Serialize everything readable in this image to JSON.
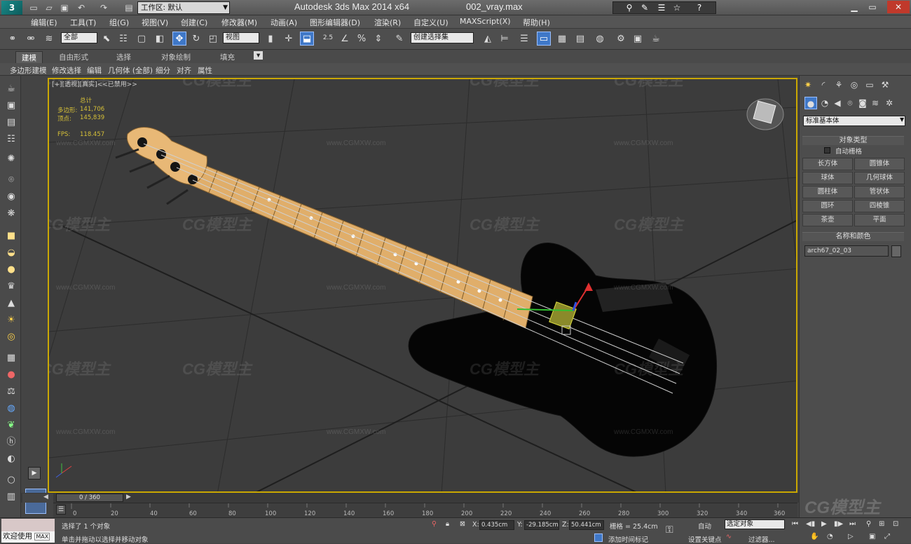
{
  "titlebar": {
    "workspace_label": "工作区: 默认",
    "app_name": "Autodesk 3ds Max  2014 x64",
    "file_name": "002_vray.max"
  },
  "menu": [
    "编辑(E)",
    "工具(T)",
    "组(G)",
    "视图(V)",
    "创建(C)",
    "修改器(M)",
    "动画(A)",
    "图形编辑器(D)",
    "渲染(R)",
    "自定义(U)",
    "MAXScript(X)",
    "帮助(H)"
  ],
  "toolbar": {
    "filter_select": "全部",
    "ref_coord_select": "视图",
    "snap_value": "2.5",
    "named_selection": "创建选择集"
  },
  "ribbon": {
    "tabs": [
      "建模",
      "自由形式",
      "选择",
      "对象绘制",
      "填充"
    ],
    "subitems": [
      "多边形建模",
      "修改选择",
      "编辑",
      "几何体 (全部)",
      "细分",
      "对齐",
      "属性"
    ]
  },
  "viewport": {
    "label": "[+][透视][真实]<<已禁用>>",
    "stats": {
      "total_label": "总计",
      "poly_label": "多边形:",
      "poly_value": "141,706",
      "vert_label": "顶点:",
      "vert_value": "145,839",
      "fps_label": "FPS:",
      "fps_value": "118.457"
    },
    "watermark": "CG模型主",
    "watermark_url": "www.CGMXW.com"
  },
  "cmdpanel": {
    "category_select": "标准基本体",
    "object_type_title": "对象类型",
    "autogrid_label": "自动栅格",
    "buttons": [
      "长方体",
      "圆锥体",
      "球体",
      "几何球体",
      "圆柱体",
      "管状体",
      "圆环",
      "四棱锥",
      "茶壶",
      "平面"
    ],
    "name_color_title": "名称和颜色",
    "object_name": "arch67_02_03",
    "object_color": "#666666"
  },
  "timeline": {
    "slider_label": "0 / 360",
    "ticks": [
      "0",
      "20",
      "40",
      "60",
      "80",
      "100",
      "120",
      "140",
      "160",
      "180",
      "200",
      "220",
      "240",
      "260",
      "280",
      "300",
      "320",
      "340",
      "360"
    ]
  },
  "status": {
    "welcome": "欢迎使用",
    "maxscript": "MAX",
    "selected": "选择了 1 个对象",
    "prompt": "单击并拖动以选择并移动对象",
    "x_label": "X:",
    "x_value": "0.435cm",
    "y_label": "Y:",
    "y_value": "-29.185cm",
    "z_label": "Z:",
    "z_value": "50.441cm",
    "grid": "栅格 = 25.4cm",
    "add_time_tag": "添加时间标记",
    "auto_key": "自动",
    "key_mode": "选定对象",
    "set_key": "设置关键点",
    "filters": "过滤器..."
  }
}
